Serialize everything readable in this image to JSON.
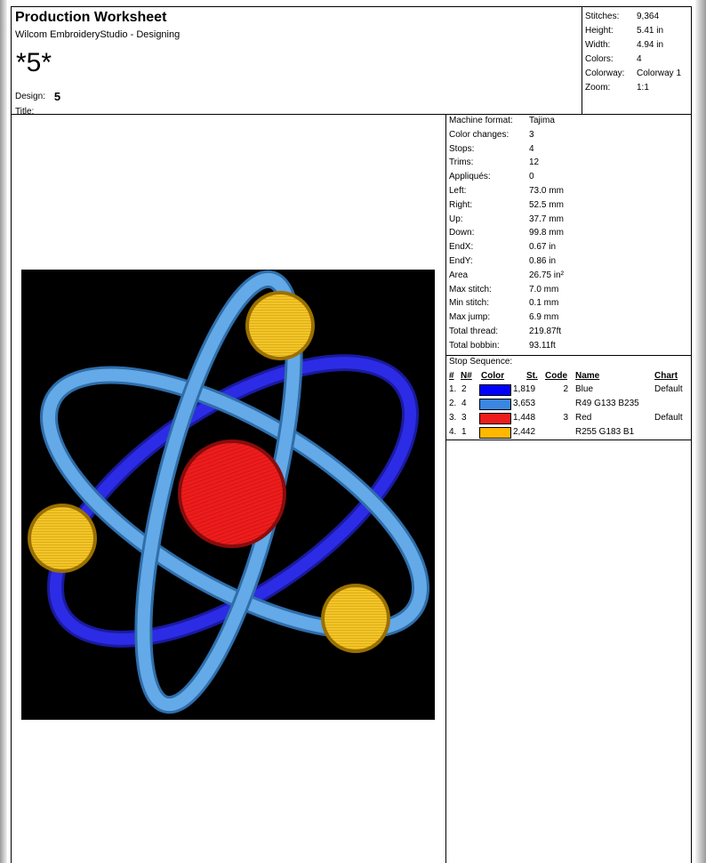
{
  "header": {
    "title": "Production Worksheet",
    "subtitle": "Wilcom EmbroideryStudio - Designing",
    "design_big": "*5*",
    "design_label": "Design:",
    "design_value": "5",
    "title_label": "Title:"
  },
  "stats": [
    {
      "label": "Stitches:",
      "value": "9,364"
    },
    {
      "label": "Height:",
      "value": "5.41 in"
    },
    {
      "label": "Width:",
      "value": "4.94 in"
    },
    {
      "label": "Colors:",
      "value": "4"
    },
    {
      "label": "Colorway:",
      "value": "Colorway 1"
    },
    {
      "label": "Zoom:",
      "value": "1:1"
    }
  ],
  "machine_info": [
    {
      "label": "Machine format:",
      "value": "Tajima"
    },
    {
      "label": "Color changes:",
      "value": "3"
    },
    {
      "label": "Stops:",
      "value": "4"
    },
    {
      "label": "Trims:",
      "value": "12"
    },
    {
      "label": "Appliqués:",
      "value": "0"
    },
    {
      "label": "Left:",
      "value": "73.0 mm"
    },
    {
      "label": "Right:",
      "value": "52.5 mm"
    },
    {
      "label": "Up:",
      "value": "37.7 mm"
    },
    {
      "label": "Down:",
      "value": "99.8 mm"
    },
    {
      "label": "EndX:",
      "value": "0.67 in"
    },
    {
      "label": "EndY:",
      "value": "0.86 in"
    },
    {
      "label": "Area",
      "value": " 26.75 in²"
    },
    {
      "label": "Max stitch:",
      "value": "7.0 mm"
    },
    {
      "label": "Min stitch:",
      "value": "0.1 mm"
    },
    {
      "label": "Max jump:",
      "value": "6.9 mm"
    },
    {
      "label": "Total thread:",
      "value": "219.87ft"
    },
    {
      "label": "Total bobbin:",
      "value": "93.11ft"
    }
  ],
  "stop_sequence": {
    "label": "Stop Sequence:",
    "headers": {
      "num": "#",
      "n": "N#",
      "color": "Color",
      "st": "St.",
      "code": "Code",
      "name": "Name",
      "chart": "Chart"
    },
    "rows": [
      {
        "num": "1.",
        "n": "2",
        "color": "#0000ff",
        "st": "1,819",
        "code": "2",
        "name": "Blue",
        "chart": "Default"
      },
      {
        "num": "2.",
        "n": "4",
        "color": "#3a86e0",
        "st": "3,653",
        "code": "",
        "name": "R49 G133 B235",
        "chart": ""
      },
      {
        "num": "3.",
        "n": "3",
        "color": "#ee1c1c",
        "st": "1,448",
        "code": "3",
        "name": "Red",
        "chart": "Default"
      },
      {
        "num": "4.",
        "n": "1",
        "color": "#ffb700",
        "st": "2,442",
        "code": "",
        "name": "R255 G183 B1",
        "chart": ""
      }
    ]
  },
  "design_colors": {
    "background": "#000000",
    "nucleus": "#ee1c1c",
    "dark_orbit": "#2626d8",
    "light_orbit": "#5ea6e6",
    "electron": "#f0c020"
  }
}
